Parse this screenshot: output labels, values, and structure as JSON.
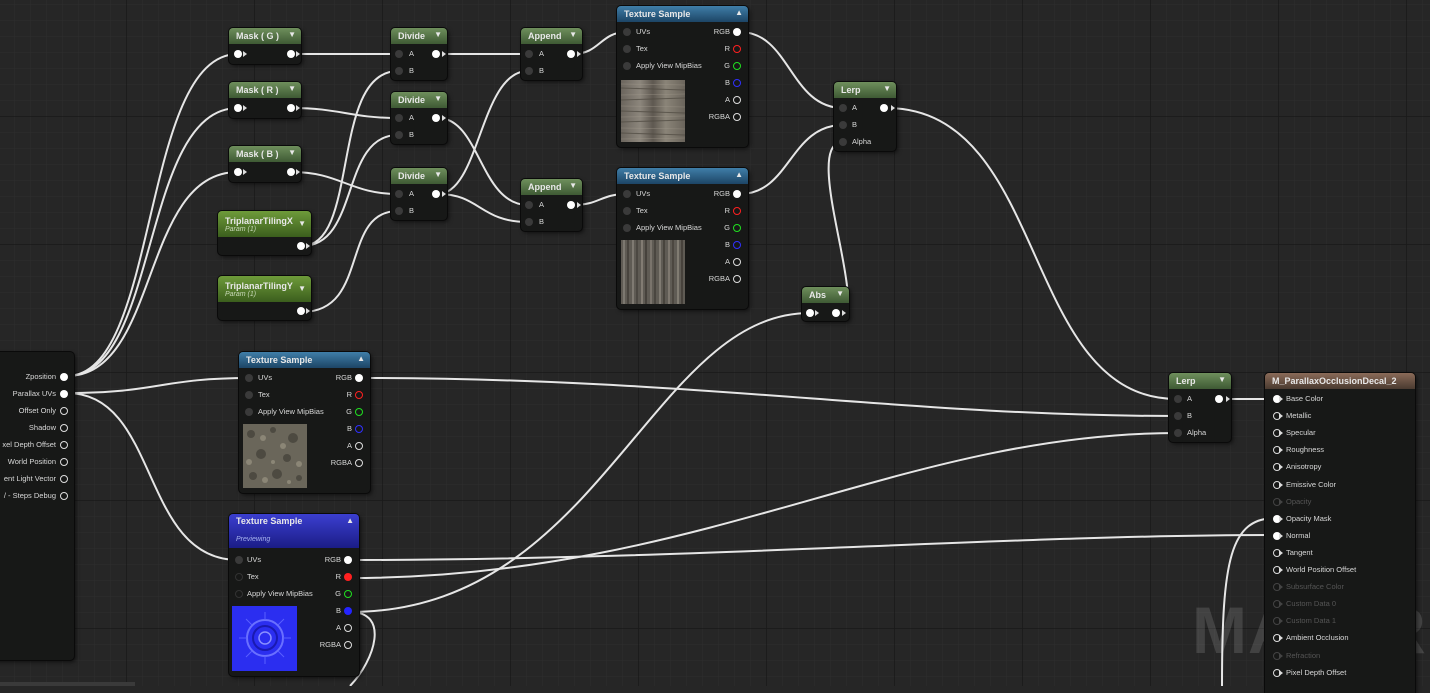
{
  "nodes": {
    "mask_g": {
      "title": "Mask ( G )"
    },
    "mask_r": {
      "title": "Mask ( R )"
    },
    "mask_b": {
      "title": "Mask ( B )"
    },
    "tiling_x": {
      "title": "TriplanarTilingX",
      "sub": "Param (1)"
    },
    "tiling_y": {
      "title": "TriplanarTilingY",
      "sub": "Param (1)"
    },
    "divide1": {
      "title": "Divide",
      "a": "A",
      "b": "B"
    },
    "divide2": {
      "title": "Divide",
      "a": "A",
      "b": "B"
    },
    "divide3": {
      "title": "Divide",
      "a": "A",
      "b": "B"
    },
    "append1": {
      "title": "Append",
      "a": "A",
      "b": "B"
    },
    "append2": {
      "title": "Append",
      "a": "A",
      "b": "B"
    },
    "tex1": {
      "title": "Texture Sample",
      "inputs": [
        "UVs",
        "Tex",
        "Apply View MipBias"
      ],
      "outputs": [
        "RGB",
        "R",
        "G",
        "B",
        "A",
        "RGBA"
      ]
    },
    "tex2": {
      "title": "Texture Sample",
      "inputs": [
        "UVs",
        "Tex",
        "Apply View MipBias"
      ],
      "outputs": [
        "RGB",
        "R",
        "G",
        "B",
        "A",
        "RGBA"
      ]
    },
    "tex3": {
      "title": "Texture Sample",
      "inputs": [
        "UVs",
        "Tex",
        "Apply View MipBias"
      ],
      "outputs": [
        "RGB",
        "R",
        "G",
        "B",
        "A",
        "RGBA"
      ]
    },
    "tex4": {
      "title": "Texture Sample",
      "sub": "Previewing",
      "inputs": [
        "UVs",
        "Tex",
        "Apply View MipBias"
      ],
      "outputs": [
        "RGB",
        "R",
        "G",
        "B",
        "A",
        "RGBA"
      ]
    },
    "lerp1": {
      "title": "Lerp",
      "a": "A",
      "b": "B",
      "alpha": "Alpha"
    },
    "lerp2": {
      "title": "Lerp",
      "a": "A",
      "b": "B",
      "alpha": "Alpha"
    },
    "abs": {
      "title": "Abs"
    },
    "pom": {
      "outputs": [
        "Zposition",
        "Parallax UVs",
        "Offset Only",
        "Shadow",
        "xel Depth Offset",
        "World Position",
        "ent Light Vector",
        "/ - Steps Debug"
      ]
    },
    "material": {
      "title": "M_ParallaxOcclusionDecal_2",
      "inputs": [
        {
          "label": "Base Color",
          "state": "on"
        },
        {
          "label": "Metallic",
          "state": "off"
        },
        {
          "label": "Specular",
          "state": "off"
        },
        {
          "label": "Roughness",
          "state": "off"
        },
        {
          "label": "Anisotropy",
          "state": "off"
        },
        {
          "label": "Emissive Color",
          "state": "off"
        },
        {
          "label": "Opacity",
          "state": "faded"
        },
        {
          "label": "Opacity Mask",
          "state": "on"
        },
        {
          "label": "Normal",
          "state": "on"
        },
        {
          "label": "Tangent",
          "state": "off"
        },
        {
          "label": "World Position Offset",
          "state": "off"
        },
        {
          "label": "Subsurface Color",
          "state": "faded"
        },
        {
          "label": "Custom Data 0",
          "state": "faded"
        },
        {
          "label": "Custom Data 1",
          "state": "faded"
        },
        {
          "label": "Ambient Occlusion",
          "state": "off"
        },
        {
          "label": "Refraction",
          "state": "faded"
        },
        {
          "label": "Pixel Depth Offset",
          "state": "off"
        }
      ]
    }
  },
  "watermark": "MATERIAL",
  "colors": {
    "background": "#262626",
    "wire": "#e6e6e6",
    "red_pin": "#ff2020",
    "green_pin": "#20e020",
    "blue_pin": "#2424ff"
  },
  "icons": {
    "collapse": "chevron-down-icon",
    "expand": "chevron-up-icon"
  }
}
